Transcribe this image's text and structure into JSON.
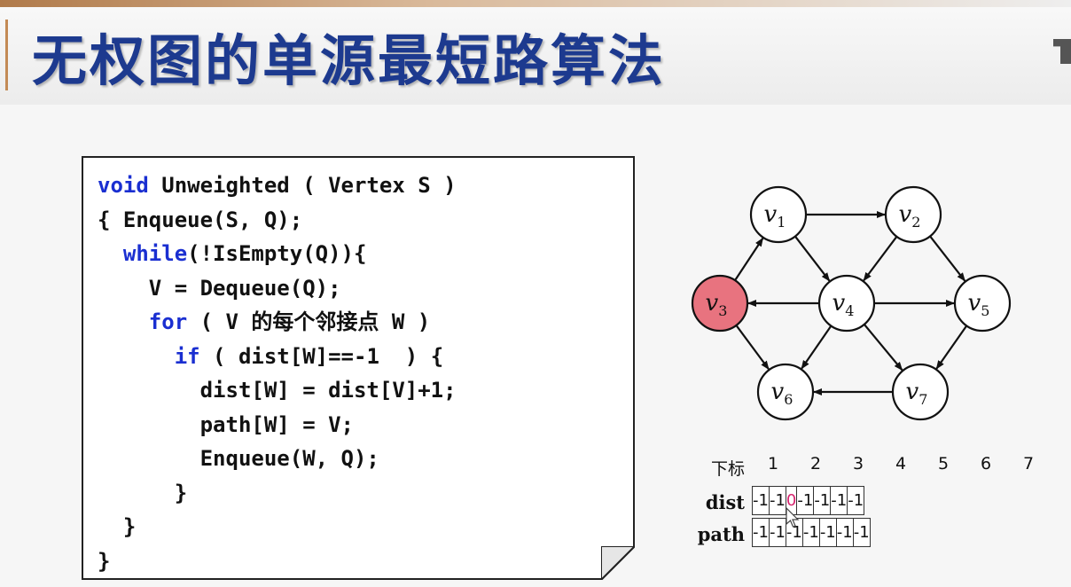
{
  "slide": {
    "title": "无权图的单源最短路算法"
  },
  "code": {
    "lines": [
      [
        {
          "t": "void",
          "kw": true
        },
        {
          "t": " Unweighted ( Vertex S )"
        }
      ],
      [
        {
          "t": "{ Enqueue(S, Q);"
        }
      ],
      [
        {
          "t": "  "
        },
        {
          "t": "while",
          "kw": true
        },
        {
          "t": "(!IsEmpty(Q)){"
        }
      ],
      [
        {
          "t": "    V = Dequeue(Q);"
        }
      ],
      [
        {
          "t": "    "
        },
        {
          "t": "for",
          "kw": true
        },
        {
          "t": " ( V 的每个邻接点 W )"
        }
      ],
      [
        {
          "t": "      "
        },
        {
          "t": "if",
          "kw": true
        },
        {
          "t": " ( dist[W]==-1  ) {"
        }
      ],
      [
        {
          "t": "        dist[W] = dist[V]+1;"
        }
      ],
      [
        {
          "t": "        path[W] = V;"
        }
      ],
      [
        {
          "t": "        Enqueue(W, Q);"
        }
      ],
      [
        {
          "t": "      }"
        }
      ],
      [
        {
          "t": "  }"
        }
      ],
      [
        {
          "t": "}"
        }
      ]
    ]
  },
  "graph": {
    "vertices": [
      {
        "id": "v1",
        "sub": "1",
        "highlight": false
      },
      {
        "id": "v2",
        "sub": "2",
        "highlight": false
      },
      {
        "id": "v3",
        "sub": "3",
        "highlight": true
      },
      {
        "id": "v4",
        "sub": "4",
        "highlight": false
      },
      {
        "id": "v5",
        "sub": "5",
        "highlight": false
      },
      {
        "id": "v6",
        "sub": "6",
        "highlight": false
      },
      {
        "id": "v7",
        "sub": "7",
        "highlight": false
      }
    ],
    "edges": [
      [
        "v1",
        "v2"
      ],
      [
        "v1",
        "v4"
      ],
      [
        "v2",
        "v4"
      ],
      [
        "v2",
        "v5"
      ],
      [
        "v3",
        "v1"
      ],
      [
        "v3",
        "v6"
      ],
      [
        "v4",
        "v3"
      ],
      [
        "v4",
        "v5"
      ],
      [
        "v4",
        "v6"
      ],
      [
        "v4",
        "v7"
      ],
      [
        "v5",
        "v7"
      ],
      [
        "v7",
        "v6"
      ]
    ],
    "highlight_color": "#e8737f"
  },
  "table": {
    "index_label": "下标",
    "indices": [
      "1",
      "2",
      "3",
      "4",
      "5",
      "6",
      "7"
    ],
    "dist_label": "dist",
    "dist": [
      "-1",
      "-1",
      "0",
      "-1",
      "-1",
      "-1",
      "-1"
    ],
    "dist_highlight_index": 2,
    "path_label": "path",
    "path": [
      "-1",
      "-1",
      "-1",
      "-1",
      "-1",
      "-1",
      "-1"
    ]
  }
}
